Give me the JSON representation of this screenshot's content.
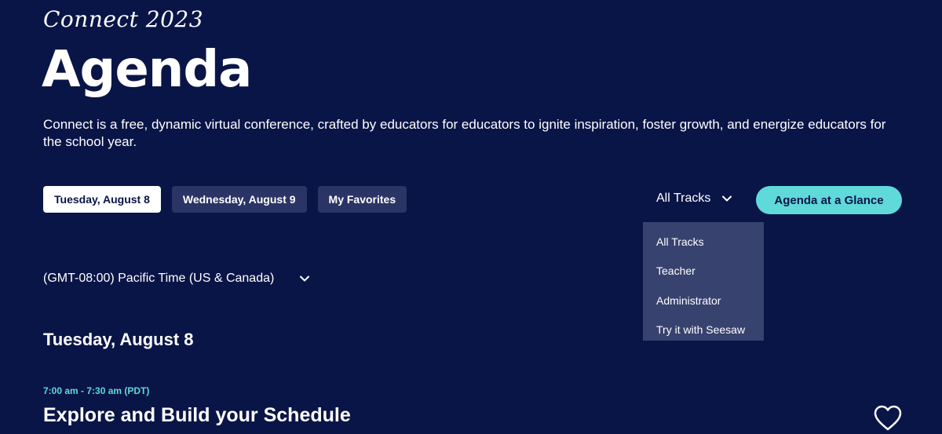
{
  "header": {
    "eyebrow": "Connect 2023",
    "title": "Agenda",
    "intro": "Connect is a free, dynamic virtual conference, crafted by educators for educators to ignite inspiration, foster growth, and energize educators for the school year."
  },
  "tabs": [
    {
      "label": "Tuesday, August 8",
      "active": true
    },
    {
      "label": "Wednesday, August 9",
      "active": false
    },
    {
      "label": "My Favorites",
      "active": false
    }
  ],
  "track_filter": {
    "selected": "All Tracks",
    "options": [
      "All Tracks",
      "Teacher",
      "Administrator",
      "Try it with Seesaw"
    ]
  },
  "glance_button": "Agenda at a Glance",
  "timezone": "(GMT-08:00) Pacific Time (US & Canada)",
  "day_heading": "Tuesday, August 8",
  "session": {
    "time": "7:00 am - 7:30 am (PDT)",
    "title": "Explore and Build your Schedule"
  },
  "colors": {
    "background": "#0a1547",
    "accent": "#5fd9d9",
    "tab_inactive": "#2a3566",
    "dropdown_bg": "#38426e"
  },
  "icons": {
    "dropdown": "chevron-down-icon",
    "favorite": "heart-outline-icon"
  }
}
